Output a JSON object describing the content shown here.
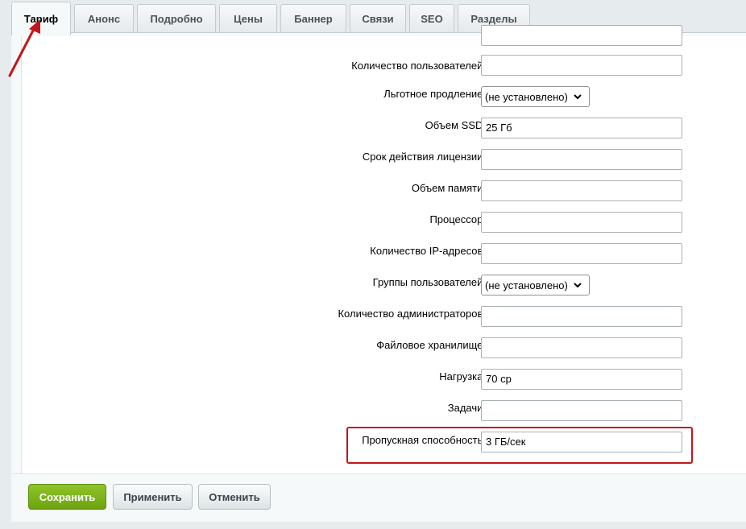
{
  "tabs": [
    {
      "label": "Тариф",
      "active": true
    },
    {
      "label": "Анонс"
    },
    {
      "label": "Подробно"
    },
    {
      "label": "Цены"
    },
    {
      "label": "Баннер"
    },
    {
      "label": "Связи"
    },
    {
      "label": "SEO"
    },
    {
      "label": "Разделы"
    }
  ],
  "form": {
    "users_label": "Количество пользователей:",
    "users_value": "",
    "grace_label": "Льготное продление:",
    "grace_value": "(не установлено)",
    "ssd_label": "Объем SSD:",
    "ssd_value": "25 Гб",
    "license_label": "Срок действия лицензии:",
    "license_value": "",
    "memory_label": "Объем памяти:",
    "memory_value": "",
    "cpu_label": "Процессор:",
    "cpu_value": "",
    "ip_label": "Количество IP-адресов:",
    "ip_value": "",
    "groups_label": "Группы пользователей:",
    "groups_value": "(не установлено)",
    "admins_label": "Количество администраторов:",
    "admins_value": "",
    "storage_label": "Файловое хранилище:",
    "storage_value": "",
    "load_label": "Нагрузка:",
    "load_value": "70 ср",
    "tasks_label": "Задачи:",
    "tasks_value": "",
    "bandwidth_label": "Пропускная способность:",
    "bandwidth_value": "3 ГБ/сек"
  },
  "buttons": {
    "save": "Сохранить",
    "apply": "Применить",
    "cancel": "Отменить"
  },
  "colors": {
    "annotation": "#c4161c",
    "save_button": "#7cb518"
  }
}
